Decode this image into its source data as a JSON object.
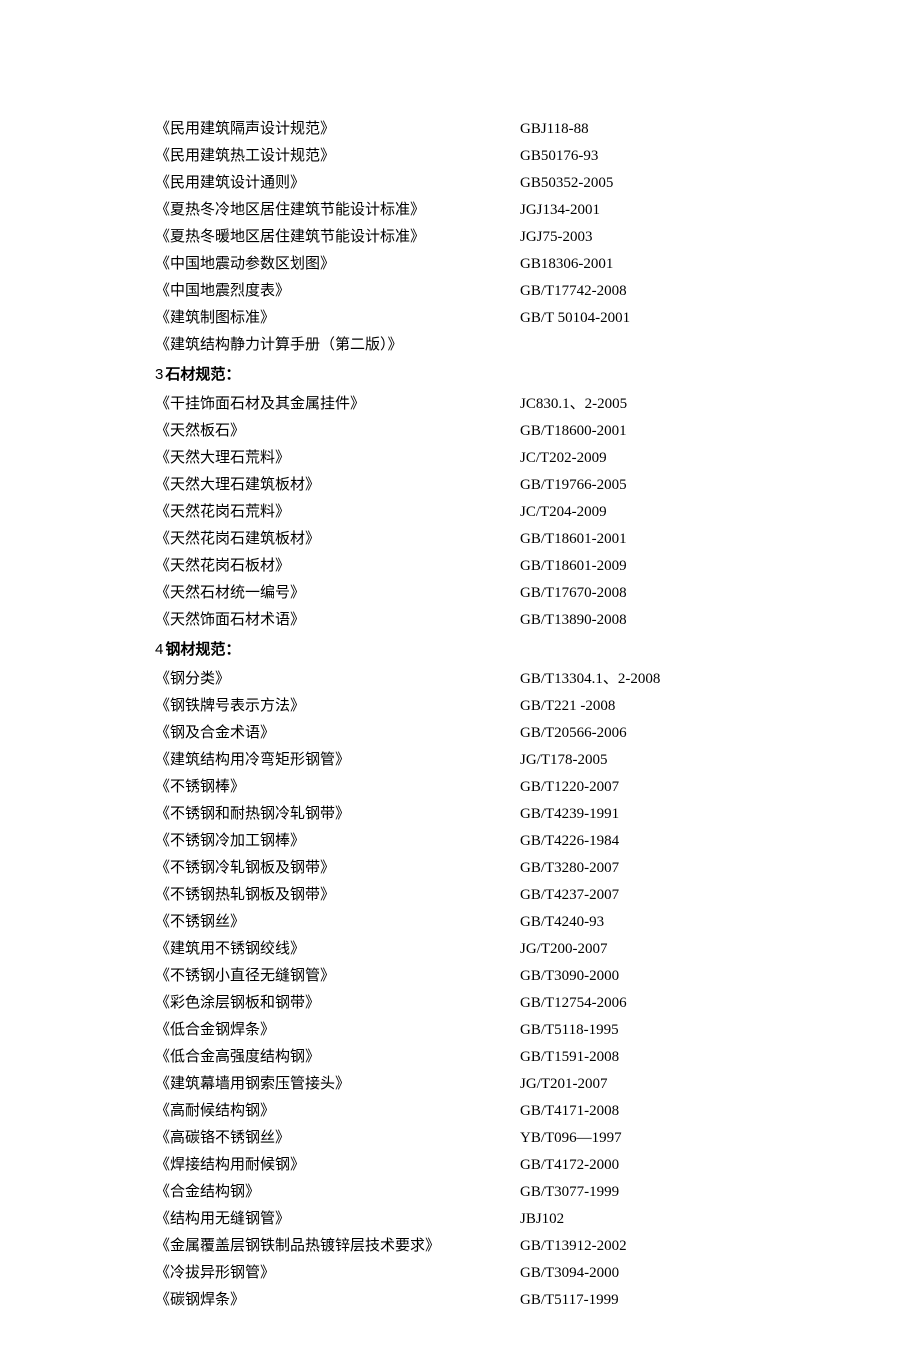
{
  "sections": [
    {
      "heading": null,
      "rows": [
        {
          "title": "《民用建筑隔声设计规范》",
          "code": "GBJ118-88"
        },
        {
          "title": "《民用建筑热工设计规范》",
          "code": "GB50176-93"
        },
        {
          "title": "《民用建筑设计通则》",
          "code": "GB50352-2005"
        },
        {
          "title": "《夏热冬冷地区居住建筑节能设计标准》",
          "code": "JGJ134-2001"
        },
        {
          "title": "《夏热冬暖地区居住建筑节能设计标准》",
          "code": "JGJ75-2003"
        },
        {
          "title": "《中国地震动参数区划图》",
          "code": "GB18306-2001"
        },
        {
          "title": "《中国地震烈度表》",
          "code": "GB/T17742-2008"
        },
        {
          "title": "《建筑制图标准》",
          "code": "GB/T 50104-2001"
        },
        {
          "title": "《建筑结构静力计算手册（第二版）》",
          "code": ""
        }
      ]
    },
    {
      "heading": {
        "num": "3",
        "text": "石材规范："
      },
      "rows": [
        {
          "title": "《干挂饰面石材及其金属挂件》",
          "code": "JC830.1、2-2005"
        },
        {
          "title": "《天然板石》",
          "code": "GB/T18600-2001"
        },
        {
          "title": "《天然大理石荒料》",
          "code": "JC/T202-2009"
        },
        {
          "title": "《天然大理石建筑板材》",
          "code": "GB/T19766-2005"
        },
        {
          "title": "《天然花岗石荒料》",
          "code": "JC/T204-2009"
        },
        {
          "title": "《天然花岗石建筑板材》",
          "code": "GB/T18601-2001"
        },
        {
          "title": "《天然花岗石板材》",
          "code": "GB/T18601-2009"
        },
        {
          "title": "《天然石材统一编号》",
          "code": "GB/T17670-2008"
        },
        {
          "title": "《天然饰面石材术语》",
          "code": "GB/T13890-2008"
        }
      ]
    },
    {
      "heading": {
        "num": "4",
        "text": "钢材规范："
      },
      "rows": [
        {
          "title": "《钢分类》",
          "code": "GB/T13304.1、2-2008"
        },
        {
          "title": "《钢铁牌号表示方法》",
          "code": "GB/T221 -2008"
        },
        {
          "title": "《钢及合金术语》",
          "code": "GB/T20566-2006"
        },
        {
          "title": "《建筑结构用冷弯矩形钢管》",
          "code": "JG/T178-2005"
        },
        {
          "title": "《不锈钢棒》",
          "code": "GB/T1220-2007"
        },
        {
          "title": "《不锈钢和耐热钢冷轧钢带》",
          "code": "GB/T4239-1991"
        },
        {
          "title": "《不锈钢冷加工钢棒》",
          "code": "GB/T4226-1984"
        },
        {
          "title": "《不锈钢冷轧钢板及钢带》",
          "code": "GB/T3280-2007"
        },
        {
          "title": "《不锈钢热轧钢板及钢带》",
          "code": "GB/T4237-2007"
        },
        {
          "title": "《不锈钢丝》",
          "code": "GB/T4240-93"
        },
        {
          "title": "《建筑用不锈钢绞线》",
          "code": "JG/T200-2007"
        },
        {
          "title": "《不锈钢小直径无缝钢管》",
          "code": "GB/T3090-2000"
        },
        {
          "title": "《彩色涂层钢板和钢带》",
          "code": "GB/T12754-2006"
        },
        {
          "title": "《低合金钢焊条》",
          "code": "GB/T5118-1995"
        },
        {
          "title": "《低合金高强度结构钢》",
          "code": "GB/T1591-2008"
        },
        {
          "title": "《建筑幕墙用钢索压管接头》",
          "code": "JG/T201-2007"
        },
        {
          "title": "《高耐候结构钢》",
          "code": "GB/T4171-2008"
        },
        {
          "title": "《高碳铬不锈钢丝》",
          "code": "YB/T096—1997"
        },
        {
          "title": "《焊接结构用耐候钢》",
          "code": "GB/T4172-2000"
        },
        {
          "title": "《合金结构钢》",
          "code": "GB/T3077-1999"
        },
        {
          "title": "《结构用无缝钢管》",
          "code": "JBJ102"
        },
        {
          "title": "《金属覆盖层钢铁制品热镀锌层技术要求》",
          "code": "GB/T13912-2002"
        },
        {
          "title": "《冷拔异形钢管》",
          "code": "GB/T3094-2000"
        },
        {
          "title": "《碳钢焊条》",
          "code": "GB/T5117-1999"
        }
      ]
    }
  ]
}
